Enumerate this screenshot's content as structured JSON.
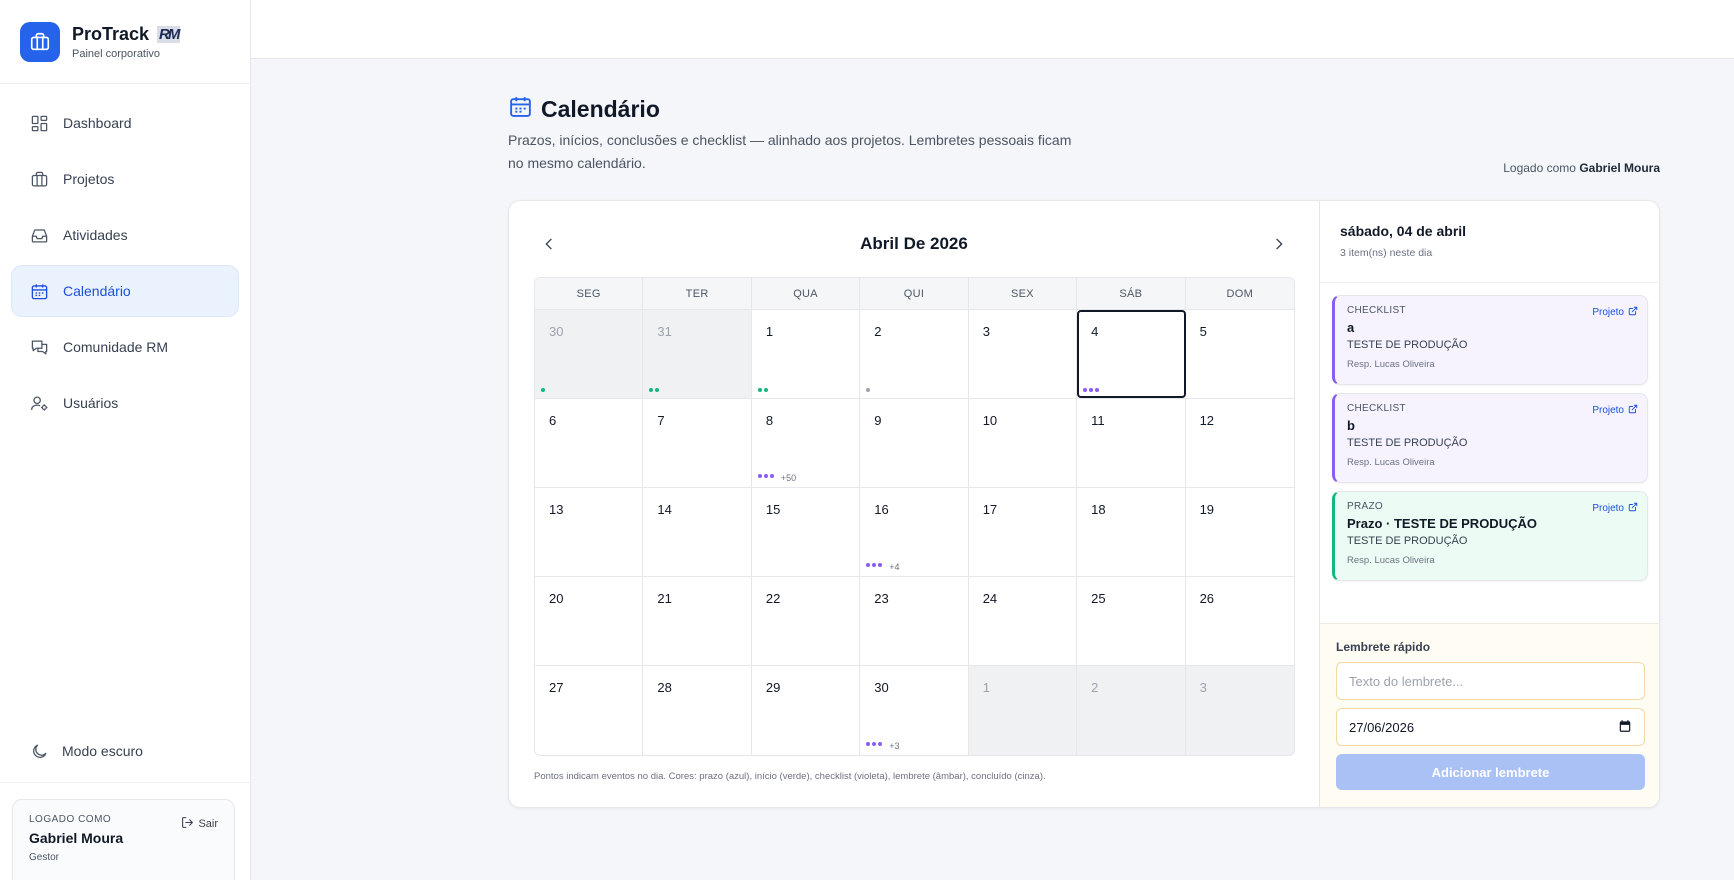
{
  "brand": {
    "name": "ProTrack",
    "badge": "RM",
    "subtitle": "Painel corporativo"
  },
  "nav": [
    {
      "label": "Dashboard",
      "icon": "dashboard-icon"
    },
    {
      "label": "Projetos",
      "icon": "briefcase-icon"
    },
    {
      "label": "Atividades",
      "icon": "inbox-icon"
    },
    {
      "label": "Calendário",
      "icon": "calendar-icon",
      "active": true
    },
    {
      "label": "Comunidade RM",
      "icon": "chat-icon"
    },
    {
      "label": "Usuários",
      "icon": "user-gear-icon"
    }
  ],
  "dark_mode_label": "Modo escuro",
  "user": {
    "label": "LOGADO COMO",
    "name": "Gabriel Moura",
    "role": "Gestor",
    "logout": "Sair"
  },
  "page": {
    "title": "Calendário",
    "description": "Prazos, inícios, conclusões e checklist — alinhado aos projetos. Lembretes pessoais ficam no mesmo calendário.",
    "logged_prefix": "Logado como",
    "logged_name": "Gabriel Moura"
  },
  "calendar": {
    "month_title": "Abril De 2026",
    "weekdays": [
      "SEG",
      "TER",
      "QUA",
      "QUI",
      "SEX",
      "SÁB",
      "DOM"
    ],
    "colors": {
      "prazo": "#2563eb",
      "inicio": "#10b981",
      "checklist": "#8b5cf6",
      "lembrete": "#f59e0b",
      "concluido": "#9ca3af"
    },
    "weeks": [
      [
        {
          "n": "30",
          "out": true,
          "dots": [
            "inicio"
          ]
        },
        {
          "n": "31",
          "out": true,
          "dots": [
            "inicio",
            "inicio"
          ]
        },
        {
          "n": "1",
          "dots": [
            "inicio",
            "inicio"
          ]
        },
        {
          "n": "2",
          "dots": [
            "concluido"
          ]
        },
        {
          "n": "3"
        },
        {
          "n": "4",
          "selected": true,
          "dots": [
            "checklist",
            "checklist",
            "checklist"
          ]
        },
        {
          "n": "5"
        }
      ],
      [
        {
          "n": "6"
        },
        {
          "n": "7"
        },
        {
          "n": "8",
          "dots": [
            "checklist",
            "checklist",
            "checklist"
          ],
          "more": "+50"
        },
        {
          "n": "9"
        },
        {
          "n": "10"
        },
        {
          "n": "11"
        },
        {
          "n": "12"
        }
      ],
      [
        {
          "n": "13"
        },
        {
          "n": "14"
        },
        {
          "n": "15"
        },
        {
          "n": "16",
          "dots": [
            "checklist",
            "checklist",
            "checklist"
          ],
          "more": "+4"
        },
        {
          "n": "17"
        },
        {
          "n": "18"
        },
        {
          "n": "19"
        }
      ],
      [
        {
          "n": "20"
        },
        {
          "n": "21"
        },
        {
          "n": "22"
        },
        {
          "n": "23"
        },
        {
          "n": "24"
        },
        {
          "n": "25"
        },
        {
          "n": "26"
        }
      ],
      [
        {
          "n": "27"
        },
        {
          "n": "28"
        },
        {
          "n": "29"
        },
        {
          "n": "30",
          "dots": [
            "checklist",
            "checklist",
            "checklist"
          ],
          "more": "+3"
        },
        {
          "n": "1",
          "out": true
        },
        {
          "n": "2",
          "out": true
        },
        {
          "n": "3",
          "out": true
        }
      ]
    ],
    "legend": "Pontos indicam eventos no dia. Cores: prazo (azul), início (verde), checklist (violeta), lembrete (âmbar), concluído (cinza)."
  },
  "panel": {
    "date": "sábado, 04 de abril",
    "count": "3 item(ns) neste dia",
    "events": [
      {
        "kind": "CHECKLIST",
        "title": "a",
        "project": "TESTE DE PRODUÇÃO",
        "resp": "Resp. Lucas Oliveira",
        "link": "Projeto",
        "color": "violet"
      },
      {
        "kind": "CHECKLIST",
        "title": "b",
        "project": "TESTE DE PRODUÇÃO",
        "resp": "Resp. Lucas Oliveira",
        "link": "Projeto",
        "color": "violet"
      },
      {
        "kind": "PRAZO",
        "title": "Prazo · TESTE DE PRODUÇÃO",
        "project": "TESTE DE PRODUÇÃO",
        "resp": "Resp. Lucas Oliveira",
        "link": "Projeto",
        "color": "green"
      }
    ],
    "quick": {
      "label": "Lembrete rápido",
      "placeholder": "Texto do lembrete...",
      "date_value": "27/06/2026",
      "button": "Adicionar lembrete"
    }
  }
}
